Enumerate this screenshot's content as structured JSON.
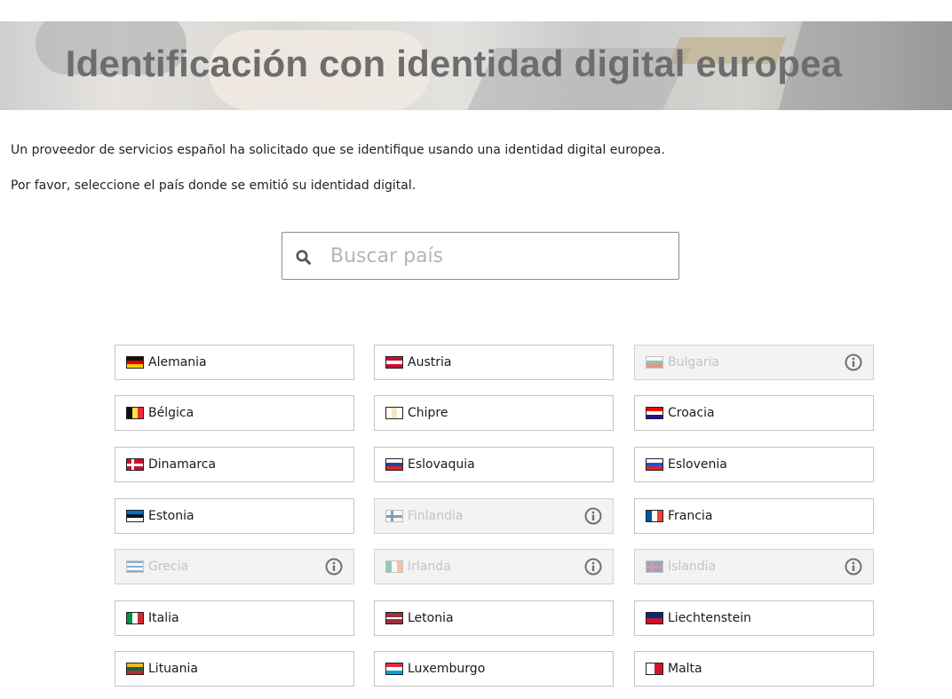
{
  "header": {
    "title": "Identificación con identidad digital europea"
  },
  "intro": {
    "line1": "Un proveedor de servicios español ha solicitado que se identifique usando una identidad digital europea.",
    "line2": "Por favor, seleccione el país donde se emitió su identidad digital."
  },
  "search": {
    "placeholder": "Buscar país",
    "value": "",
    "icon": "search-icon"
  },
  "countries": [
    {
      "label": "Alemania",
      "enabled": true,
      "flag": "germany-flag-icon"
    },
    {
      "label": "Austria",
      "enabled": true,
      "flag": "austria-flag-icon"
    },
    {
      "label": "Bulgaria",
      "enabled": false,
      "flag": "bulgaria-flag-icon"
    },
    {
      "label": "Bélgica",
      "enabled": true,
      "flag": "belgium-flag-icon"
    },
    {
      "label": "Chipre",
      "enabled": true,
      "flag": "cyprus-flag-icon"
    },
    {
      "label": "Croacia",
      "enabled": true,
      "flag": "croatia-flag-icon"
    },
    {
      "label": "Dinamarca",
      "enabled": true,
      "flag": "denmark-flag-icon"
    },
    {
      "label": "Eslovaquia",
      "enabled": true,
      "flag": "slovakia-flag-icon"
    },
    {
      "label": "Eslovenia",
      "enabled": true,
      "flag": "slovenia-flag-icon"
    },
    {
      "label": "Estonia",
      "enabled": true,
      "flag": "estonia-flag-icon"
    },
    {
      "label": "Finlandia",
      "enabled": false,
      "flag": "finland-flag-icon"
    },
    {
      "label": "Francia",
      "enabled": true,
      "flag": "france-flag-icon"
    },
    {
      "label": "Grecia",
      "enabled": false,
      "flag": "greece-flag-icon"
    },
    {
      "label": "Irlanda",
      "enabled": false,
      "flag": "ireland-flag-icon"
    },
    {
      "label": "Islandia",
      "enabled": false,
      "flag": "iceland-flag-icon"
    },
    {
      "label": "Italia",
      "enabled": true,
      "flag": "italy-flag-icon"
    },
    {
      "label": "Letonia",
      "enabled": true,
      "flag": "latvia-flag-icon"
    },
    {
      "label": "Liechtenstein",
      "enabled": true,
      "flag": "liechtenstein-flag-icon"
    },
    {
      "label": "Lituania",
      "enabled": true,
      "flag": "lithuania-flag-icon"
    },
    {
      "label": "Luxemburgo",
      "enabled": true,
      "flag": "luxembourg-flag-icon"
    },
    {
      "label": "Malta",
      "enabled": true,
      "flag": "malta-flag-icon"
    }
  ],
  "info_icon": "info-circle-icon",
  "colors": {
    "title": "#6d6d6d",
    "border": "#c4c4c4",
    "disabled_bg": "#f3f3f3",
    "disabled_text": "#c3c3c3"
  }
}
